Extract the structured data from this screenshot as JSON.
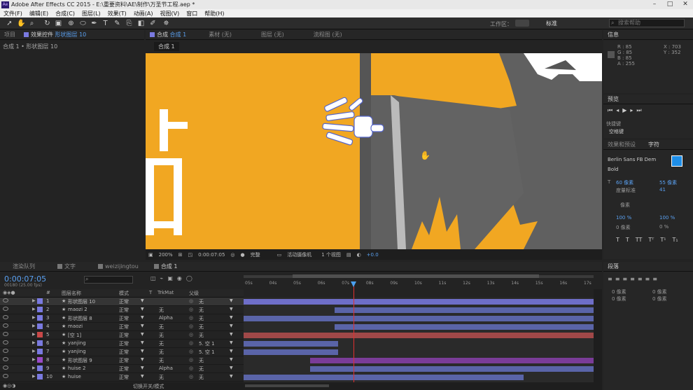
{
  "app_title": "Adobe After Effects CC 2015 - E:\\重要资料\\AE\\制作\\万圣节工程.aep *",
  "menu": [
    "文件(F)",
    "编辑(E)",
    "合成(C)",
    "图层(L)",
    "效果(T)",
    "动画(A)",
    "视图(V)",
    "窗口",
    "帮助(H)"
  ],
  "toolbar": {
    "workspace_label": "工作区：",
    "workspace_value": "标准",
    "search_placeholder": "搜索帮助"
  },
  "project_panel": {
    "tab": "项目",
    "effects_tab": "效果控件",
    "effects_layer": "形状图层 10",
    "breadcrumb": "合成 1 • 形状图层 10"
  },
  "viewer": {
    "tabs": [
      "合成",
      "合成 1",
      "素材 (无)",
      "图层 (无)",
      "流程图 (无)"
    ],
    "sub_tab": "合成 1",
    "zoom": "200%",
    "timecode": "0:00:07:05",
    "quality": "完整",
    "camera": "活动摄像机",
    "views": "1 个视图",
    "exposure": "+0.0"
  },
  "info_panel": {
    "title": "信息",
    "r": "R : 85",
    "g": "G : 85",
    "b": "B : 85",
    "a": "A : 255",
    "x": "X : 703",
    "y": "Y : 352"
  },
  "preview_panel": {
    "title": "预览",
    "shortcut_label": "快捷键",
    "shortcut_value": "空格键"
  },
  "effects_panel": {
    "tab1": "效果和预设",
    "tab2": "字符",
    "font": "Berlin Sans FB Dem",
    "style": "Bold",
    "size": "60 像素",
    "leading": "55 像素",
    "tracking_label": "度量标准",
    "tracking": "41",
    "stroke_label": "像素",
    "unit1": "像素",
    "scale_v": "100 %",
    "scale_h": "100 %",
    "baseline": "0 像素",
    "tsume": "0 %",
    "text_btns": [
      "T",
      "T",
      "TT",
      "Tᵀ",
      "T¹",
      "T₁"
    ]
  },
  "paragraph_panel": {
    "title": "段落",
    "indent": "0 像素"
  },
  "timeline": {
    "tabs": [
      "渲染队列",
      "文字",
      "weizijingtou",
      "合成 1"
    ],
    "timecode": "0:00:07:05",
    "fps": "00180 (25.00 fps)",
    "col_name": "图层名称",
    "col_mode": "模式",
    "col_t": "T",
    "col_trkmat": "TrkMat",
    "col_parent": "父级",
    "ticks": [
      "05s",
      "04s",
      "05s",
      "06s",
      "07s",
      "08s",
      "09s",
      "10s",
      "11s",
      "12s",
      "13s",
      "14s",
      "15s",
      "16s",
      "17s"
    ],
    "footer": "切换开关/模式",
    "layers": [
      {
        "num": "1",
        "name": "形状图层 10",
        "mode": "正常",
        "trkmat": "",
        "parent": "无",
        "color": "#7a7ae0",
        "bar_start": 0.0,
        "bar_end": 1.0,
        "bar_color": "#6e6ec8"
      },
      {
        "num": "2",
        "name": "maozi 2",
        "mode": "正常",
        "trkmat": "无",
        "parent": "无",
        "color": "#7a7ae0",
        "bar_start": 0.26,
        "bar_end": 1.0,
        "bar_color": "#5a64a8"
      },
      {
        "num": "3",
        "name": "形状图层 8",
        "mode": "正常",
        "trkmat": "Alpha",
        "parent": "无",
        "color": "#7a7ae0",
        "bar_start": 0.0,
        "bar_end": 1.0,
        "bar_color": "#5a64a8"
      },
      {
        "num": "4",
        "name": "maozi",
        "mode": "正常",
        "trkmat": "无",
        "parent": "无",
        "color": "#7a7ae0",
        "bar_start": 0.26,
        "bar_end": 1.0,
        "bar_color": "#5a64a8"
      },
      {
        "num": "5",
        "name": "[空 1]",
        "mode": "正常",
        "trkmat": "无",
        "parent": "无",
        "color": "#c84848",
        "bar_start": 0.0,
        "bar_end": 1.0,
        "bar_color": "#a04848"
      },
      {
        "num": "6",
        "name": "yanjing",
        "mode": "正常",
        "trkmat": "无",
        "parent": "5. 空 1",
        "color": "#7a7ae0",
        "bar_start": 0.0,
        "bar_end": 0.27,
        "bar_color": "#5a64a8"
      },
      {
        "num": "7",
        "name": "yanjing",
        "mode": "正常",
        "trkmat": "无",
        "parent": "5. 空 1",
        "color": "#7a7ae0",
        "bar_start": 0.0,
        "bar_end": 0.27,
        "bar_color": "#5a64a8"
      },
      {
        "num": "8",
        "name": "形状图层 9",
        "mode": "正常",
        "trkmat": "无",
        "parent": "无",
        "color": "#9a4ac8",
        "bar_start": 0.19,
        "bar_end": 1.0,
        "bar_color": "#7a3c98"
      },
      {
        "num": "9",
        "name": "huise 2",
        "mode": "正常",
        "trkmat": "Alpha",
        "parent": "无",
        "color": "#7a7ae0",
        "bar_start": 0.19,
        "bar_end": 1.0,
        "bar_color": "#5a64a8"
      },
      {
        "num": "10",
        "name": "huise",
        "mode": "正常",
        "trkmat": "无",
        "parent": "无",
        "color": "#7a7ae0",
        "bar_start": 0.0,
        "bar_end": 0.8,
        "bar_color": "#5a64a8"
      }
    ]
  },
  "colors": {
    "viewer_bg": "#f1a722",
    "accent": "#5aa0f0",
    "playhead": "#e03030"
  }
}
